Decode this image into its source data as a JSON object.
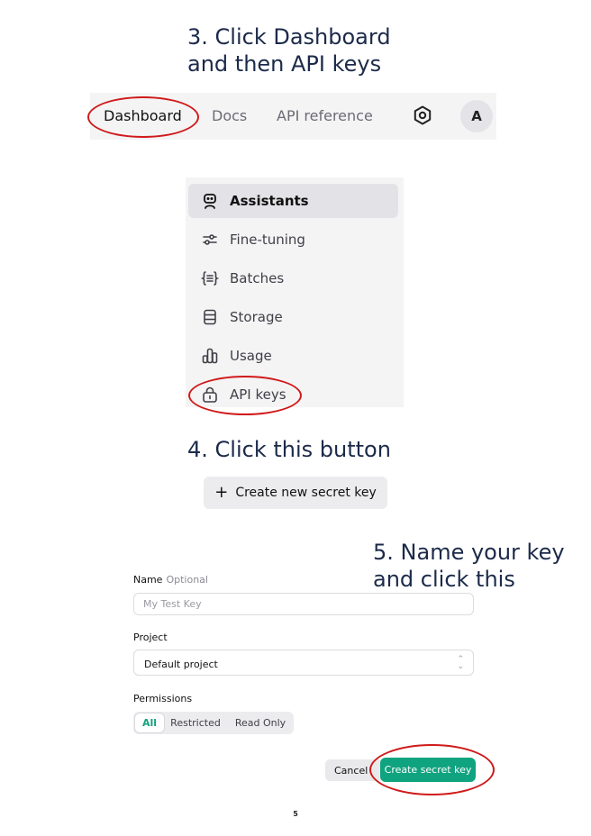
{
  "steps": {
    "step3": [
      "3. Click Dashboard",
      "and then API keys"
    ],
    "step4": "4. Click this button",
    "step5": [
      "5. Name your key",
      "and click this"
    ]
  },
  "topnav": {
    "dashboard": "Dashboard",
    "docs": "Docs",
    "api_reference": "API reference",
    "settings_icon": "gear-icon",
    "avatar_initial": "A"
  },
  "menu": {
    "items": [
      {
        "label": "Assistants",
        "icon": "robot-icon",
        "active": true
      },
      {
        "label": "Fine-tuning",
        "icon": "sliders-icon",
        "active": false
      },
      {
        "label": "Batches",
        "icon": "braces-list-icon",
        "active": false
      },
      {
        "label": "Storage",
        "icon": "database-icon",
        "active": false
      },
      {
        "label": "Usage",
        "icon": "bar-chart-icon",
        "active": false
      },
      {
        "label": "API keys",
        "icon": "lock-icon",
        "active": false
      }
    ]
  },
  "create_new_button": {
    "label": "Create new secret key",
    "icon": "plus-icon"
  },
  "form": {
    "name_label": "Name",
    "name_optional": "Optional",
    "name_placeholder": "My Test Key",
    "project_label": "Project",
    "project_value": "Default project",
    "permissions_label": "Permissions",
    "permissions_options": [
      "All",
      "Restricted",
      "Read Only"
    ],
    "permissions_selected": "All",
    "cancel_label": "Cancel",
    "submit_label": "Create secret key"
  },
  "colors": {
    "accent_green": "#10a37f",
    "highlight_red": "#d01a1a",
    "heading_navy": "#1c2a4a"
  },
  "page_number": "5"
}
